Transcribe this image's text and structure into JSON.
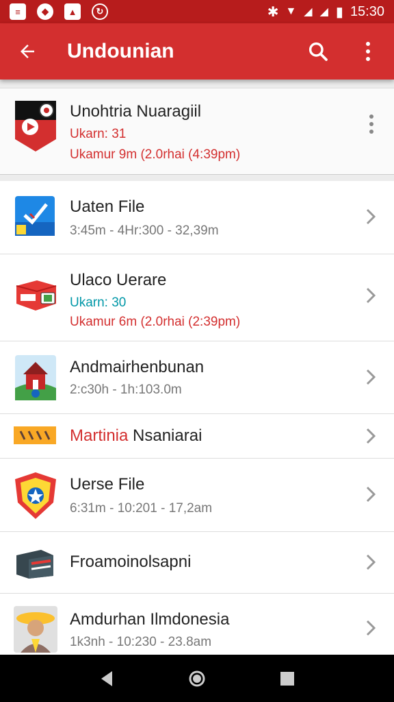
{
  "status_bar": {
    "time": "15:30",
    "indicators": [
      "notification-icon",
      "message-icon",
      "photo-icon",
      "sync-icon"
    ]
  },
  "app_bar": {
    "title": "Undounian"
  },
  "featured": {
    "title": "Unohtria Nuaragiil",
    "line1": "Ukarn: 31",
    "line2": "Ukamur 9m (2.0rhai (4:39pm)"
  },
  "items": [
    {
      "title": "Uaten File",
      "sub": "3:45m - 4Hr:300 - 32,39m",
      "icon": "checkmark-app-icon"
    },
    {
      "title": "Ulaco Uerare",
      "sub": "Ukarn: 30",
      "sub2": "Ukamur 6m (2.0rhai (2:39pm)",
      "icon": "package-icon"
    },
    {
      "title": "Andmairhenbunan",
      "sub": "2:c30h - 1h:103.0m",
      "icon": "palace-icon"
    },
    {
      "title_red": "Martinia",
      "title_rest": " Nsaniarai",
      "icon": "banner-icon"
    },
    {
      "title": "Uerse File",
      "sub": "6:31m - 10:201 - 17,2am",
      "icon": "shield-badge-icon"
    },
    {
      "title": "Froamoinolsapni",
      "icon": "box-icon"
    },
    {
      "title": "Amdurhan Ilmdonesia",
      "sub": "1k3nh - 10:230 - 23.8am",
      "icon": "farmer-icon"
    }
  ],
  "colors": {
    "primary": "#d32f2f",
    "primary_dark": "#b71c1c",
    "accent_red": "#d32f2f",
    "accent_teal": "#0097a7"
  }
}
